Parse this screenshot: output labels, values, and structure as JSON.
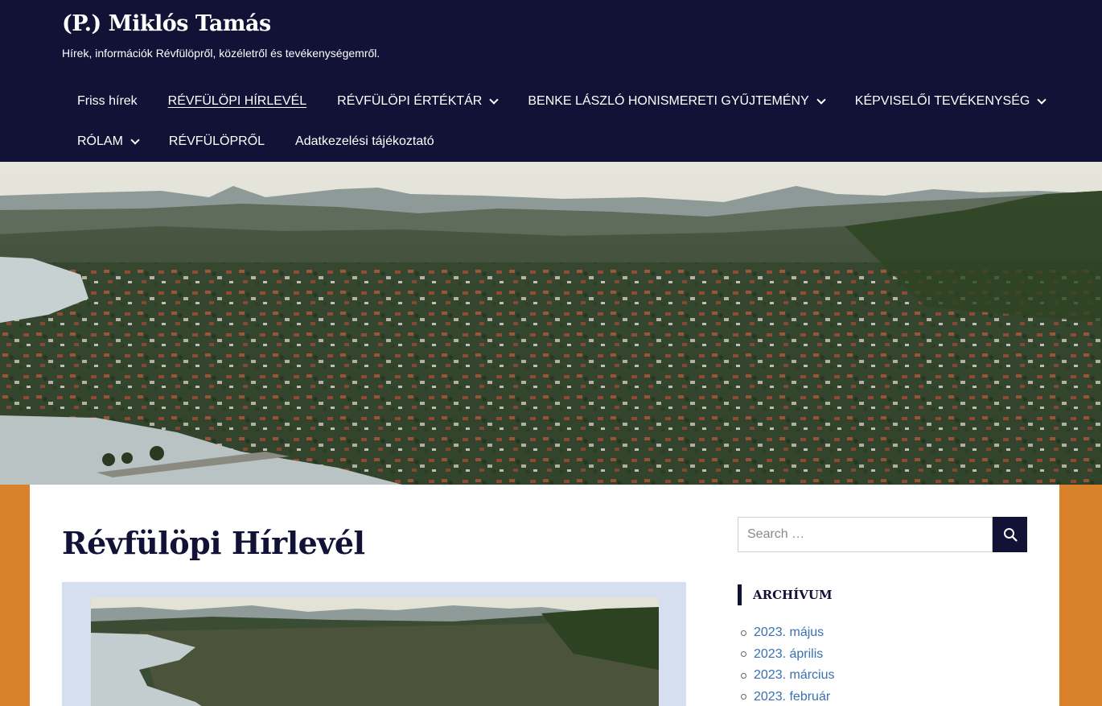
{
  "site": {
    "title": "(P.) Miklós Tamás",
    "description": "Hírek, információk Révfülöpről, közéletről és tevékenységemről."
  },
  "nav": {
    "row1": [
      {
        "label": "Friss hírek",
        "dropdown": false,
        "current": false
      },
      {
        "label": "RÉVFÜLÖPI HÍRLEVÉL",
        "dropdown": false,
        "current": true
      },
      {
        "label": "RÉVFÜLÖPI ÉRTÉKTÁR",
        "dropdown": true,
        "current": false
      },
      {
        "label": "BENKE LÁSZLÓ HONISMERETI GYŰJTEMÉNY",
        "dropdown": true,
        "current": false
      },
      {
        "label": "KÉPVISELŐI TEVÉKENYSÉG",
        "dropdown": true,
        "current": false
      }
    ],
    "row2": [
      {
        "label": "RÓLAM",
        "dropdown": true,
        "current": false
      },
      {
        "label": "RÉVFÜLÖPRŐL",
        "dropdown": false,
        "current": false
      },
      {
        "label": "Adatkezelési tájékoztató",
        "dropdown": false,
        "current": false
      }
    ]
  },
  "page": {
    "title": "Révfülöpi Hírlevél"
  },
  "sidebar": {
    "search": {
      "placeholder": "Search …",
      "value": "",
      "icon": "search-icon"
    },
    "archive": {
      "title": "ARCHÍVUM",
      "items": [
        "2023. május",
        "2023. április",
        "2023. március",
        "2023. február"
      ]
    }
  },
  "colors": {
    "header_bg": "#111236",
    "accent_orange": "#d9822b",
    "link": "#3a6fb0",
    "featured_bg": "#d5dff0"
  }
}
